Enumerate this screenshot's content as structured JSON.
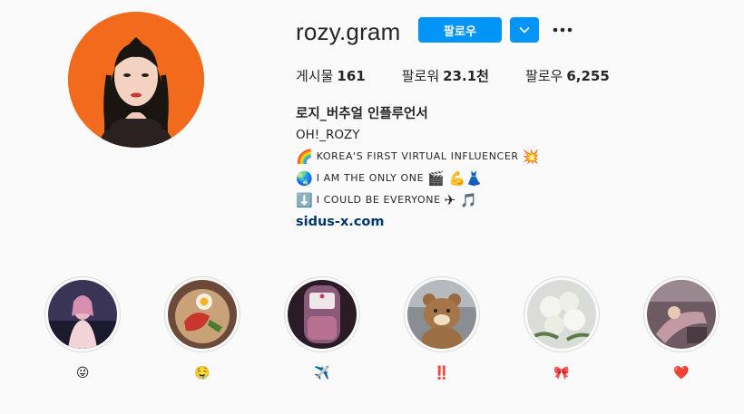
{
  "profile": {
    "username": "rozy.gram",
    "follow_label": "팔로우",
    "dropdown_icon": "chevron-down-icon",
    "more_icon": "more-horizontal-icon",
    "avatar_icon": "profile-avatar",
    "stats": [
      {
        "label": "게시물",
        "value": "161"
      },
      {
        "label": "팔로워",
        "value": "23.1천"
      },
      {
        "label": "팔로우",
        "value": "6,255"
      }
    ],
    "bio": {
      "full_name": "로지_버추얼 인플루언서",
      "line1": "OH!_ROZY",
      "line2_emoji_start": "🌈",
      "line2_text": "KOREA'S FIRST VIRTUAL INFLUENCER",
      "line2_emoji_end": "💥",
      "line3_emoji_start": "🌏",
      "line3_text": "I AM THE ONLY ONE",
      "line3_emoji_end": "🎬 💪👗",
      "line4_emoji_start": "⬇️",
      "line4_text": "I COULD BE EVERYONE",
      "line4_emoji_end": "✈ 🎵",
      "website": "sidus-x.com"
    }
  },
  "highlights": [
    {
      "label": "😜"
    },
    {
      "label": "🤤"
    },
    {
      "label": "✈️"
    },
    {
      "label": "‼️"
    },
    {
      "label": "🎀"
    },
    {
      "label": "❤️"
    }
  ],
  "colors": {
    "accent": "#0095f6",
    "link": "#00376b",
    "avatar_bg": "#f26a1b",
    "background": "#fafafa"
  }
}
